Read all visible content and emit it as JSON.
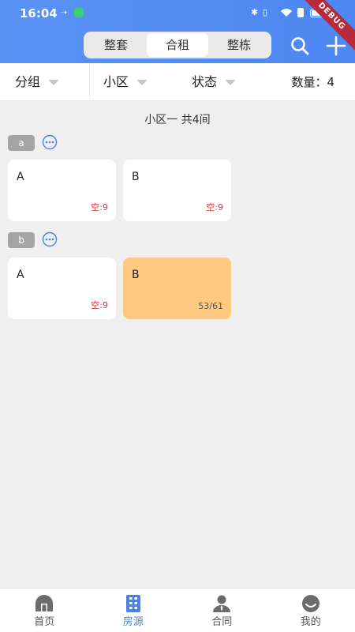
{
  "status_bar": {
    "time": "16:04",
    "debug_label": "DEBUG"
  },
  "header": {
    "segments": [
      {
        "label": "整套",
        "active": false
      },
      {
        "label": "合租",
        "active": true
      },
      {
        "label": "整栋",
        "active": false
      }
    ],
    "search_icon": "search-icon",
    "add_icon": "plus-icon"
  },
  "filters": {
    "group": "分组",
    "community": "小区",
    "status": "状态",
    "count_label": "数量：",
    "count_value": "4"
  },
  "summary": "小区一 共4间",
  "groups": [
    {
      "tag": "a",
      "rooms": [
        {
          "name": "A",
          "status": "空:9",
          "occupied": false
        },
        {
          "name": "B",
          "status": "空:9",
          "occupied": false
        }
      ]
    },
    {
      "tag": "b",
      "rooms": [
        {
          "name": "A",
          "status": "空:9",
          "occupied": false
        },
        {
          "name": "B",
          "status": "53/61",
          "occupied": true
        }
      ]
    }
  ],
  "bottom_nav": [
    {
      "label": "首页",
      "icon": "home-icon",
      "active": false
    },
    {
      "label": "房源",
      "icon": "building-icon",
      "active": true
    },
    {
      "label": "合同",
      "icon": "contract-icon",
      "active": false
    },
    {
      "label": "我的",
      "icon": "profile-icon",
      "active": false
    }
  ],
  "colors": {
    "accent": "#4a82e8",
    "occupied": "#ffc980",
    "vacant_text": "#d0393e"
  }
}
